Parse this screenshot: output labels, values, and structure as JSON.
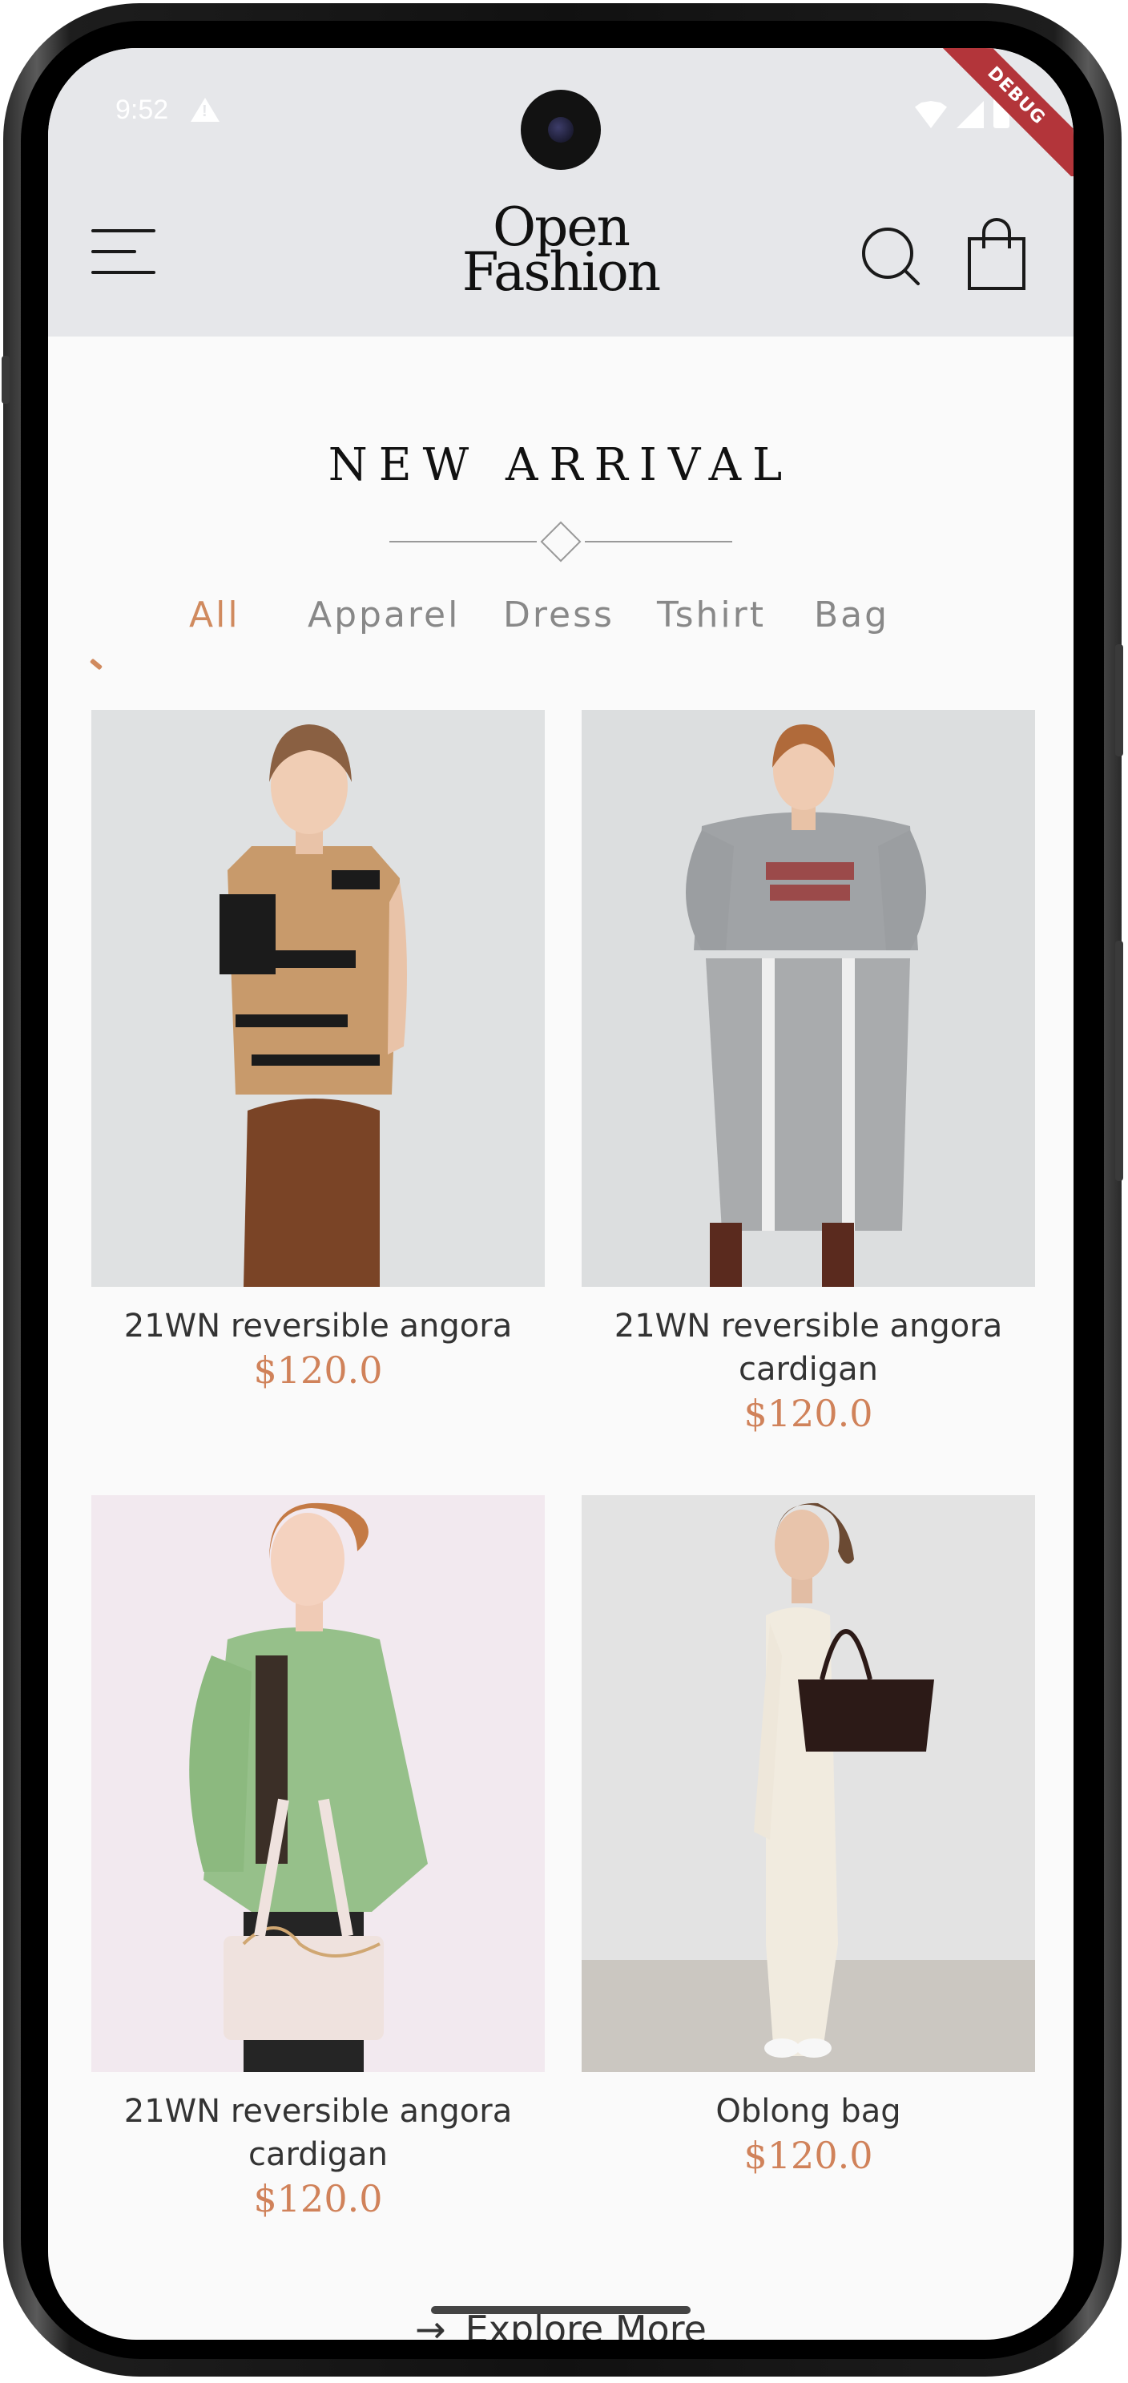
{
  "status_bar": {
    "time": "9:52",
    "debug_label": "DEBUG"
  },
  "app_bar": {
    "logo_line1": "Open",
    "logo_line2": "Fashion",
    "menu_icon": "menu-icon",
    "search_icon": "search-icon",
    "bag_icon": "shopping-bag-icon"
  },
  "section": {
    "title": "NEW ARRIVAL"
  },
  "tabs": [
    {
      "label": "All",
      "active": true
    },
    {
      "label": "Apparel",
      "active": false
    },
    {
      "label": "Dress",
      "active": false
    },
    {
      "label": "Tshirt",
      "active": false
    },
    {
      "label": "Bag",
      "active": false
    }
  ],
  "products": [
    {
      "name": "21WN reversible angora",
      "price": "$120.0"
    },
    {
      "name": "21WN reversible angora cardigan",
      "price": "$120.0"
    },
    {
      "name": "21WN reversible angora cardigan",
      "price": "$120.0"
    },
    {
      "name": "Oblong bag",
      "price": "$120.0"
    }
  ],
  "explore": {
    "label": "Explore More"
  },
  "colors": {
    "accent": "#d08a5e",
    "app_bar_bg": "#e6e7ea",
    "page_bg": "#fafafa",
    "debug_banner": "#b3353a"
  }
}
